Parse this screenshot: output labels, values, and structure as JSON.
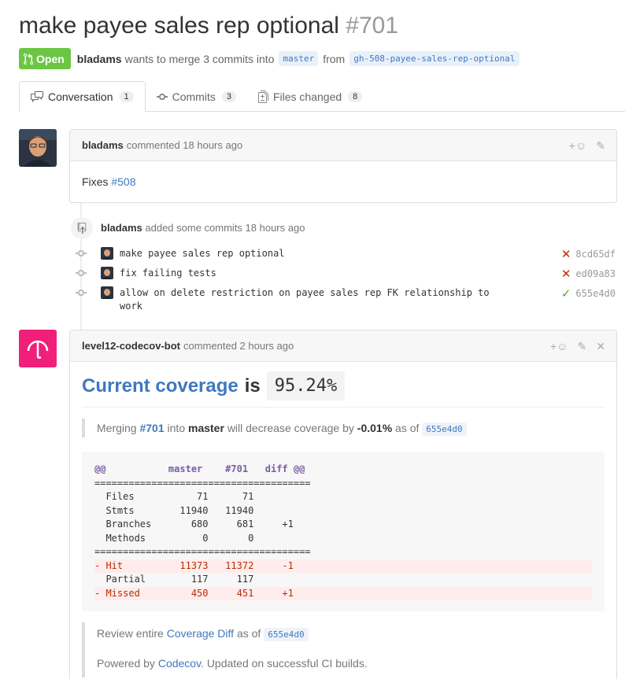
{
  "pr": {
    "title": "make payee sales rep optional",
    "number": "#701",
    "status": "Open",
    "author": "bladams",
    "merge_text": "wants to merge 3 commits into",
    "base_branch": "master",
    "from_text": "from",
    "head_branch": "gh-508-payee-sales-rep-optional"
  },
  "tabs": [
    {
      "label": "Conversation",
      "count": "1"
    },
    {
      "label": "Commits",
      "count": "3"
    },
    {
      "label": "Files changed",
      "count": "8"
    }
  ],
  "comment1": {
    "author": "bladams",
    "action": "commented 18 hours ago",
    "body_prefix": "Fixes",
    "body_link": "#508"
  },
  "event": {
    "author": "bladams",
    "action": "added some commits 18 hours ago"
  },
  "commits": [
    {
      "message": "make payee sales rep optional",
      "status": "fail",
      "sha": "8cd65df"
    },
    {
      "message": "fix failing tests",
      "status": "fail",
      "sha": "ed09a83"
    },
    {
      "message": "allow on delete restriction on payee sales rep FK relationship to work",
      "status": "success",
      "sha": "655e4d0"
    }
  ],
  "comment2": {
    "author": "level12-codecov-bot",
    "action": "commented 2 hours ago",
    "heading_link": "Current coverage",
    "heading_is": "is",
    "coverage": "95.24%",
    "merge_prefix": "Merging",
    "merge_pr": "#701",
    "merge_into": "into",
    "merge_branch": "master",
    "merge_effect": "will decrease coverage by",
    "merge_delta": "-0.01%",
    "merge_asof": "as of",
    "merge_sha": "655e4d0",
    "diff_lines": [
      {
        "type": "head",
        "text": "@@           master    #701   diff @@"
      },
      {
        "type": "plain",
        "text": "======================================"
      },
      {
        "type": "plain",
        "text": "  Files           71      71"
      },
      {
        "type": "plain",
        "text": "  Stmts        11940   11940"
      },
      {
        "type": "plain",
        "text": "  Branches       680     681     +1"
      },
      {
        "type": "plain",
        "text": "  Methods          0       0"
      },
      {
        "type": "plain",
        "text": "======================================"
      },
      {
        "type": "del",
        "text": "- Hit          11373   11372     -1  "
      },
      {
        "type": "plain",
        "text": "  Partial        117     117"
      },
      {
        "type": "del",
        "text": "- Missed         450     451     +1  "
      }
    ],
    "review_prefix": "Review entire",
    "review_link": "Coverage Diff",
    "review_asof": "as of",
    "review_sha": "655e4d0",
    "powered_prefix": "Powered by",
    "powered_link": "Codecov",
    "powered_suffix": ". Updated on successful CI builds."
  },
  "colors": {
    "open_green": "#6cc644",
    "link_blue": "#4078c0",
    "codecov_pink": "#f01f7a",
    "fail_red": "#bd2c00",
    "success_green": "#55a532"
  }
}
